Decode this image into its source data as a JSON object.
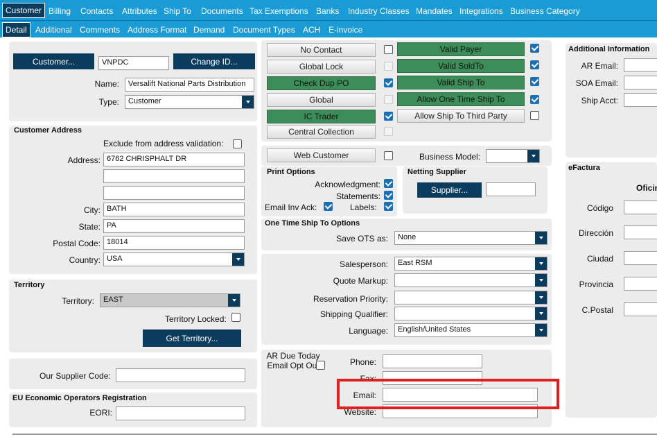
{
  "tabs_top": [
    "Customer",
    "Billing",
    "Contacts",
    "Attributes",
    "Ship To",
    "Documents",
    "Tax Exemptions",
    "Banks",
    "Industry Classes",
    "Mandates",
    "Integrations",
    "Business Category"
  ],
  "tabs_sub": [
    "Detail",
    "Additional",
    "Comments",
    "Address Format",
    "Demand",
    "Document Types",
    "ACH",
    "E-invoice"
  ],
  "customer": {
    "customer_btn": "Customer...",
    "id": "VNPDC",
    "change_id_btn": "Change ID...",
    "name_label": "Name:",
    "name": "Versalift National Parts Distribution",
    "type_label": "Type:",
    "type": "Customer"
  },
  "address": {
    "title": "Customer Address",
    "exclude_label": "Exclude from address validation:",
    "address_label": "Address:",
    "address1": "6762 CHRISPHALT DR",
    "address2": "",
    "address3": "",
    "city_label": "City:",
    "city": "BATH",
    "state_label": "State:",
    "state": "PA",
    "postal_label": "Postal Code:",
    "postal": "18014",
    "country_label": "Country:",
    "country": "USA"
  },
  "territory": {
    "title": "Territory",
    "territory_label": "Territory:",
    "territory": "EAST",
    "locked_label": "Territory Locked:",
    "get_btn": "Get Territory..."
  },
  "supplier_code": {
    "label": "Our Supplier Code:",
    "value": ""
  },
  "eu": {
    "title": "EU Economic Operators Registration",
    "eori_label": "EORI:",
    "eori": ""
  },
  "flags": {
    "no_contact": "No Contact",
    "global_lock": "Global Lock",
    "check_dup_po": "Check Dup PO",
    "global": "Global",
    "ic_trader": "IC Trader",
    "central_collection": "Central Collection",
    "valid_payer": "Valid Payer",
    "valid_soldto": "Valid SoldTo",
    "valid_shipto": "Valid Ship To",
    "allow_one_time": "Allow One Time Ship To",
    "allow_third_party": "Allow Ship To Third Party"
  },
  "web": {
    "web_customer": "Web Customer",
    "business_model_label": "Business Model:",
    "business_model": ""
  },
  "print": {
    "title": "Print Options",
    "acknowledgment": "Acknowledgment:",
    "statements": "Statements:",
    "email_inv_ack": "Email Inv Ack:",
    "labels": "Labels:"
  },
  "netting": {
    "title": "Netting Supplier",
    "supplier_btn": "Supplier...",
    "supplier": ""
  },
  "ots": {
    "title": "One Time Ship To Options",
    "save_label": "Save OTS as:",
    "save_value": "None"
  },
  "sales": {
    "salesperson_label": "Salesperson:",
    "salesperson": "East RSM",
    "quote_label": "Quote Markup:",
    "quote": "",
    "reservation_label": "Reservation Priority:",
    "reservation": "",
    "shipping_label": "Shipping Qualifier:",
    "shipping": "",
    "language_label": "Language:",
    "language": "English/United States"
  },
  "contact": {
    "ar_due_label": "AR Due Today Email Opt Out",
    "phone_label": "Phone:",
    "phone": "",
    "fax_label": "Fax:",
    "fax": "",
    "email_label": "Email:",
    "email": "",
    "website_label": "Website:",
    "website": ""
  },
  "additional": {
    "title": "Additional Information",
    "ar_email": "AR Email:",
    "soa_email": "SOA Email:",
    "ship_acct": "Ship Acct:"
  },
  "efactura": {
    "title": "eFactura",
    "oficina": "Oficin",
    "codigo": "Código",
    "direccion": "Dirección",
    "ciudad": "Ciudad",
    "provincia": "Provincia",
    "cpostal": "C.Postal"
  },
  "colors": {
    "tab_bar": "#1a9bd6",
    "button": "#0b3c5d",
    "toggle_on": "#3c8d5a",
    "highlight": "#e02020"
  }
}
